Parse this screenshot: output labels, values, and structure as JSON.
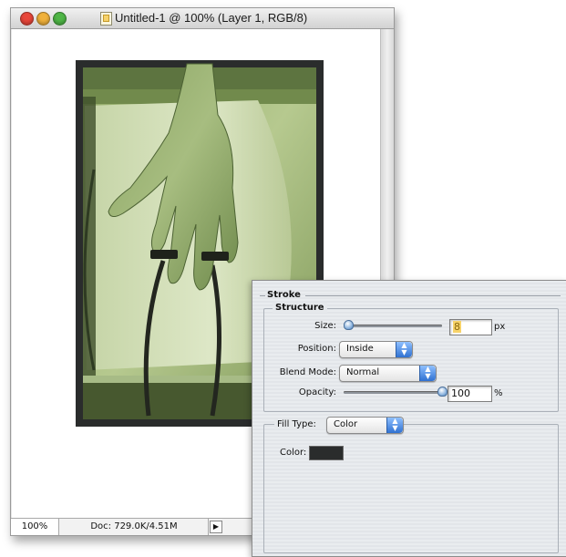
{
  "window": {
    "title": "Untitled-1 @ 100% (Layer 1, RGB/8)",
    "zoom": "100%",
    "doc_size": "Doc: 729.0K/4.51M",
    "status_arrow": "▶"
  },
  "stroke_dialog": {
    "title": "Stroke",
    "structure": {
      "title": "Structure",
      "size_label": "Size:",
      "size_value": "8",
      "size_unit": "px",
      "size_slider_fraction": 0.05,
      "position_label": "Position:",
      "position_value": "Inside",
      "blend_mode_label": "Blend Mode:",
      "blend_mode_value": "Normal",
      "opacity_label": "Opacity:",
      "opacity_value": "100",
      "opacity_unit": "%",
      "opacity_slider_fraction": 1.0
    },
    "fill": {
      "fill_type_label": "Fill Type:",
      "fill_type_value": "Color",
      "color_label": "Color:",
      "color_value": "#2a2c2c"
    }
  },
  "colors": {
    "close": "#e8463a",
    "minimize": "#f0b13b",
    "zoom": "#4fb646",
    "photo_tint": "#9fb97a",
    "photo_frame": "#2a2c2c"
  },
  "icons": {
    "close": "close-button-icon",
    "minimize": "minimize-button-icon",
    "zoom": "zoom-button-icon",
    "document": "document-icon",
    "popup_arrows": "up-down-arrows-icon"
  }
}
